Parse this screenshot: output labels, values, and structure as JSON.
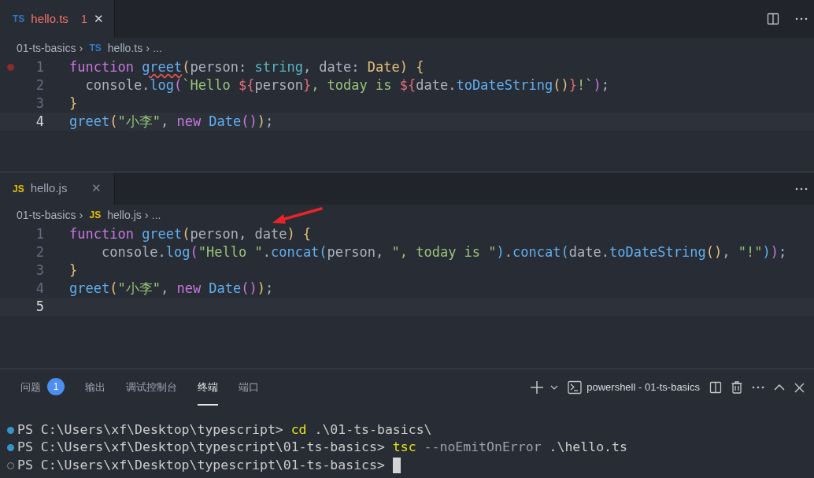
{
  "editors": [
    {
      "tab": {
        "kind": "ts",
        "badge": "TS",
        "name": "hello.ts",
        "error": true,
        "problems": "1",
        "close": "✕"
      },
      "breadcrumb": {
        "folder": "01-ts-basics",
        "separator": "›",
        "kind": "ts",
        "badge": "TS",
        "file": "hello.ts",
        "separator_2": "›",
        "rest": "..."
      },
      "actions": [
        {
          "kind": "split"
        },
        {
          "kind": "more"
        }
      ],
      "lines": [
        {
          "number": "1",
          "breakpoint": true,
          "current": false,
          "tokens": [
            {
              "text": "function ",
              "kind": "keyword"
            },
            {
              "text": "greet",
              "kind": "function",
              "squiggle": true
            },
            {
              "text": "(",
              "kind": "bracket1"
            },
            {
              "text": "person: ",
              "kind": "plain"
            },
            {
              "text": "string",
              "kind": "type"
            },
            {
              "text": ", date: ",
              "kind": "plain"
            },
            {
              "text": "Date",
              "kind": "class"
            },
            {
              "text": ") {",
              "kind": "bracket1"
            }
          ]
        },
        {
          "number": "2",
          "breakpoint": false,
          "current": false,
          "tokens": [
            {
              "text": "  console.",
              "kind": "plain"
            },
            {
              "text": "log",
              "kind": "function"
            },
            {
              "text": "(",
              "kind": "bracket2"
            },
            {
              "text": "`Hello ",
              "kind": "string"
            },
            {
              "text": "${",
              "kind": "interp"
            },
            {
              "text": "person",
              "kind": "plain"
            },
            {
              "text": "}",
              "kind": "interp"
            },
            {
              "text": ", today is ",
              "kind": "string"
            },
            {
              "text": "${",
              "kind": "interp"
            },
            {
              "text": "date.",
              "kind": "plain"
            },
            {
              "text": "toDateString",
              "kind": "function"
            },
            {
              "text": "()",
              "kind": "bracket1"
            },
            {
              "text": "}",
              "kind": "interp"
            },
            {
              "text": "!`",
              "kind": "string"
            },
            {
              "text": ")",
              "kind": "bracket2"
            },
            {
              "text": ";",
              "kind": "plain"
            }
          ]
        },
        {
          "number": "3",
          "breakpoint": false,
          "current": false,
          "tokens": [
            {
              "text": "}",
              "kind": "bracket1"
            }
          ]
        },
        {
          "number": "4",
          "breakpoint": false,
          "current": true,
          "tokens": [
            {
              "text": "greet",
              "kind": "function"
            },
            {
              "text": "(",
              "kind": "bracket1"
            },
            {
              "text": "\"小李\"",
              "kind": "string"
            },
            {
              "text": ", ",
              "kind": "plain"
            },
            {
              "text": "new ",
              "kind": "keyword"
            },
            {
              "text": "Date",
              "kind": "function"
            },
            {
              "text": "()",
              "kind": "bracket2"
            },
            {
              "text": ")",
              "kind": "bracket1"
            },
            {
              "text": ";",
              "kind": "plain"
            }
          ]
        }
      ]
    },
    {
      "tab": {
        "kind": "js",
        "badge": "JS",
        "name": "hello.js",
        "error": false,
        "close": "✕"
      },
      "breadcrumb": {
        "folder": "01-ts-basics",
        "separator": "›",
        "kind": "js",
        "badge": "JS",
        "file": "hello.js",
        "separator_2": "›",
        "rest": "..."
      },
      "actions": [
        {
          "kind": "more"
        }
      ],
      "annotation": {
        "kind": "arrow"
      },
      "lines": [
        {
          "number": "1",
          "breakpoint": false,
          "current": false,
          "tokens": [
            {
              "text": "function ",
              "kind": "keyword"
            },
            {
              "text": "greet",
              "kind": "function"
            },
            {
              "text": "(",
              "kind": "bracket1"
            },
            {
              "text": "person, date",
              "kind": "plain"
            },
            {
              "text": ") {",
              "kind": "bracket1"
            }
          ]
        },
        {
          "number": "2",
          "breakpoint": false,
          "current": false,
          "tokens": [
            {
              "text": "    console.",
              "kind": "plain"
            },
            {
              "text": "log",
              "kind": "function"
            },
            {
              "text": "(",
              "kind": "bracket2"
            },
            {
              "text": "\"Hello \"",
              "kind": "string"
            },
            {
              "text": ".",
              "kind": "plain"
            },
            {
              "text": "concat",
              "kind": "function"
            },
            {
              "text": "(",
              "kind": "bracket3"
            },
            {
              "text": "person, ",
              "kind": "plain"
            },
            {
              "text": "\", today is \"",
              "kind": "string"
            },
            {
              "text": ")",
              "kind": "bracket3"
            },
            {
              "text": ".",
              "kind": "plain"
            },
            {
              "text": "concat",
              "kind": "function"
            },
            {
              "text": "(",
              "kind": "bracket3"
            },
            {
              "text": "date.",
              "kind": "plain"
            },
            {
              "text": "toDateString",
              "kind": "function"
            },
            {
              "text": "()",
              "kind": "bracket1"
            },
            {
              "text": ", ",
              "kind": "plain"
            },
            {
              "text": "\"!\"",
              "kind": "string"
            },
            {
              "text": ")",
              "kind": "bracket3"
            },
            {
              "text": ")",
              "kind": "bracket2"
            },
            {
              "text": ";",
              "kind": "plain"
            }
          ]
        },
        {
          "number": "3",
          "breakpoint": false,
          "current": false,
          "tokens": [
            {
              "text": "}",
              "kind": "bracket1"
            }
          ]
        },
        {
          "number": "4",
          "breakpoint": false,
          "current": false,
          "tokens": [
            {
              "text": "greet",
              "kind": "function"
            },
            {
              "text": "(",
              "kind": "bracket1"
            },
            {
              "text": "\"小李\"",
              "kind": "string"
            },
            {
              "text": ", ",
              "kind": "plain"
            },
            {
              "text": "new ",
              "kind": "keyword"
            },
            {
              "text": "Date",
              "kind": "function"
            },
            {
              "text": "()",
              "kind": "bracket2"
            },
            {
              "text": ")",
              "kind": "bracket1"
            },
            {
              "text": ";",
              "kind": "plain"
            }
          ]
        },
        {
          "number": "5",
          "breakpoint": false,
          "current": true
        }
      ]
    }
  ],
  "panel": {
    "tabs": [
      {
        "label": "问题",
        "badge": "1",
        "selected": false
      },
      {
        "label": "输出",
        "selected": false
      },
      {
        "label": "调试控制台",
        "selected": false
      },
      {
        "label": "终端",
        "selected": true
      },
      {
        "label": "端口",
        "selected": false
      }
    ],
    "terminal_name": "powershell - 01-ts-basics",
    "lines": [
      {
        "done": true,
        "cursor": false,
        "segments": [
          {
            "text": "PS C:\\Users\\xf\\Desktop\\typescript> ",
            "kind": "prompt"
          },
          {
            "text": "cd",
            "kind": "command"
          },
          {
            "text": " .\\01-ts-basics\\",
            "kind": "arg"
          }
        ]
      },
      {
        "done": true,
        "cursor": false,
        "segments": [
          {
            "text": "PS C:\\Users\\xf\\Desktop\\typescript\\01-ts-basics> ",
            "kind": "prompt"
          },
          {
            "text": "tsc",
            "kind": "command"
          },
          {
            "text": " --noEmitOnError",
            "kind": "flag"
          },
          {
            "text": " .\\hello.ts",
            "kind": "arg"
          }
        ]
      },
      {
        "done": false,
        "cursor": true,
        "segments": [
          {
            "text": "PS C:\\Users\\xf\\Desktop\\typescript\\01-ts-basics> ",
            "kind": "prompt"
          }
        ]
      }
    ]
  }
}
